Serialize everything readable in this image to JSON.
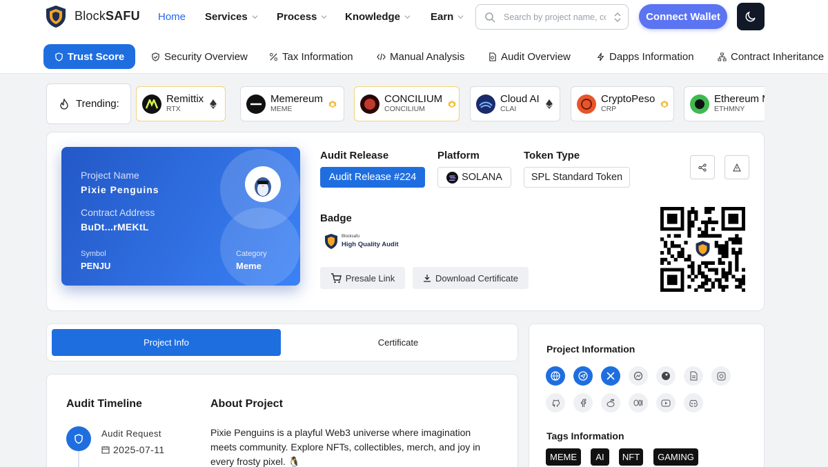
{
  "header": {
    "brand_prefix": "Block",
    "brand_suffix": "SAFU",
    "nav": [
      {
        "label": "Home"
      },
      {
        "label": "Services"
      },
      {
        "label": "Process"
      },
      {
        "label": "Knowledge"
      },
      {
        "label": "Earn"
      }
    ],
    "search_placeholder": "Search by project name, contract address...",
    "connect_label": "Connect Wallet",
    "theme_icon": "moon-icon"
  },
  "subnav": [
    "Trust Score",
    "Security Overview",
    "Tax Information",
    "Manual Analysis",
    "Audit Overview",
    "Dapps Information",
    "Contract Inheritance"
  ],
  "trending": {
    "label": "Trending:",
    "items": [
      {
        "name": "Remittix",
        "symbol": "RTX",
        "chain": "ethereum"
      },
      {
        "name": "Memereum",
        "symbol": "MEME",
        "chain": "bnb"
      },
      {
        "name": "CONCILIUM",
        "symbol": "CONCILIUM",
        "chain": "bnb"
      },
      {
        "name": "Cloud AI",
        "symbol": "CLAI",
        "chain": "ethereum"
      },
      {
        "name": "CryptoPeso",
        "symbol": "CRP",
        "chain": "bnb"
      },
      {
        "name": "Ethereum M",
        "symbol": "ETHMNY",
        "chain": ""
      }
    ]
  },
  "project": {
    "name_label": "Project Name",
    "name": "Pixie Penguins",
    "contract_label": "Contract Address",
    "contract": "BuDt...rMEKtL",
    "symbol_label": "Symbol",
    "symbol": "PENJU",
    "category_label": "Category",
    "category": "Meme"
  },
  "audit": {
    "release_label": "Audit Release",
    "release": "Audit Release #224",
    "platform_label": "Platform",
    "platform": "SOLANA",
    "token_label": "Token Type",
    "token": "SPL Standard Token",
    "badge_label": "Badge",
    "badge_brand": "Blocksafu",
    "badge_text": "High Quality Audit",
    "presale_label": "Presale Link",
    "download_label": "Download Certificate"
  },
  "tabs": [
    "Project Info",
    "Certificate"
  ],
  "timeline": {
    "title": "Audit Timeline",
    "step": "Audit Request",
    "date": "2025-07-11"
  },
  "about": {
    "title": "About Project",
    "text": "Pixie Penguins is a playful Web3 universe where imagination meets community. Explore NFTs, collectibles, merch, and joy in every frosty pixel. 🐧"
  },
  "side": {
    "info_title": "Project Information",
    "tags_title": "Tags Information",
    "tags": [
      "MEME",
      "AI",
      "NFT",
      "GAMING"
    ]
  },
  "colors": {
    "accent": "#1f6ee0",
    "connect": "#5b74f2"
  }
}
